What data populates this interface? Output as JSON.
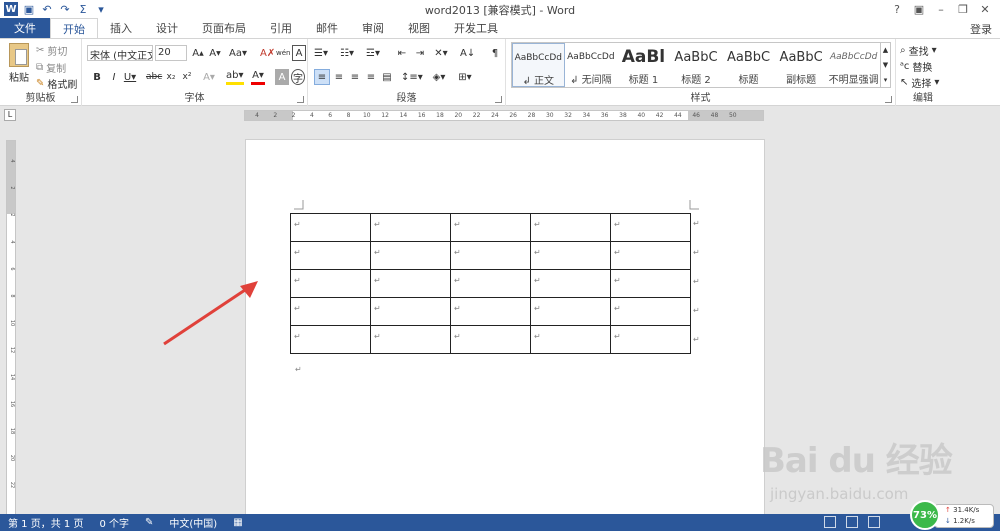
{
  "window": {
    "title": "word2013 [兼容模式] - Word",
    "login": "登录",
    "controls": [
      "?",
      "▣",
      "–",
      "❐",
      "✕"
    ]
  },
  "tabs": [
    "文件",
    "开始",
    "插入",
    "设计",
    "页面布局",
    "引用",
    "邮件",
    "审阅",
    "视图",
    "开发工具"
  ],
  "clipboard": {
    "paste": "粘贴",
    "cut": "剪切",
    "copy": "复制",
    "format_painter": "格式刷",
    "label": "剪贴板"
  },
  "font": {
    "name": "宋体 (中文正文)",
    "size": "20",
    "label": "字体"
  },
  "paragraph": {
    "label": "段落"
  },
  "styles": {
    "label": "样式",
    "items": [
      {
        "sample": "AaBbCcDd",
        "name": "↲ 正文"
      },
      {
        "sample": "AaBbCcDd",
        "name": "↲ 无间隔"
      },
      {
        "sample": "AaBl",
        "name": "标题 1"
      },
      {
        "sample": "AaBbC",
        "name": "标题 2"
      },
      {
        "sample": "AaBbC",
        "name": "标题"
      },
      {
        "sample": "AaBbC",
        "name": "副标题"
      },
      {
        "sample": "AaBbCcDd",
        "name": "不明显强调"
      }
    ]
  },
  "editing": {
    "find": "查找",
    "replace": "替换",
    "select": "选择",
    "label": "编辑"
  },
  "ruler": {
    "h_ticks": [
      "4",
      "2",
      "2",
      "4",
      "6",
      "8",
      "10",
      "12",
      "14",
      "16",
      "18",
      "20",
      "22",
      "24",
      "26",
      "28",
      "30",
      "32",
      "34",
      "36",
      "38",
      "40",
      "42",
      "44",
      "46",
      "48",
      "50"
    ],
    "v_ticks": [
      "4",
      "2",
      "2",
      "4",
      "6",
      "8",
      "10",
      "12",
      "14",
      "16",
      "18",
      "20",
      "22"
    ]
  },
  "document": {
    "para_mark": "↵",
    "table": {
      "rows": 5,
      "cols": 5
    }
  },
  "watermark": {
    "main": "Bai du 经验",
    "sub": "jingyan.baidu.com"
  },
  "status": {
    "page": "第 1 页，共 1 页",
    "words": "0 个字",
    "language": "中文(中国)"
  },
  "network": {
    "percent": "73%",
    "up": "31.4K/s",
    "down": "1.2K/s"
  }
}
